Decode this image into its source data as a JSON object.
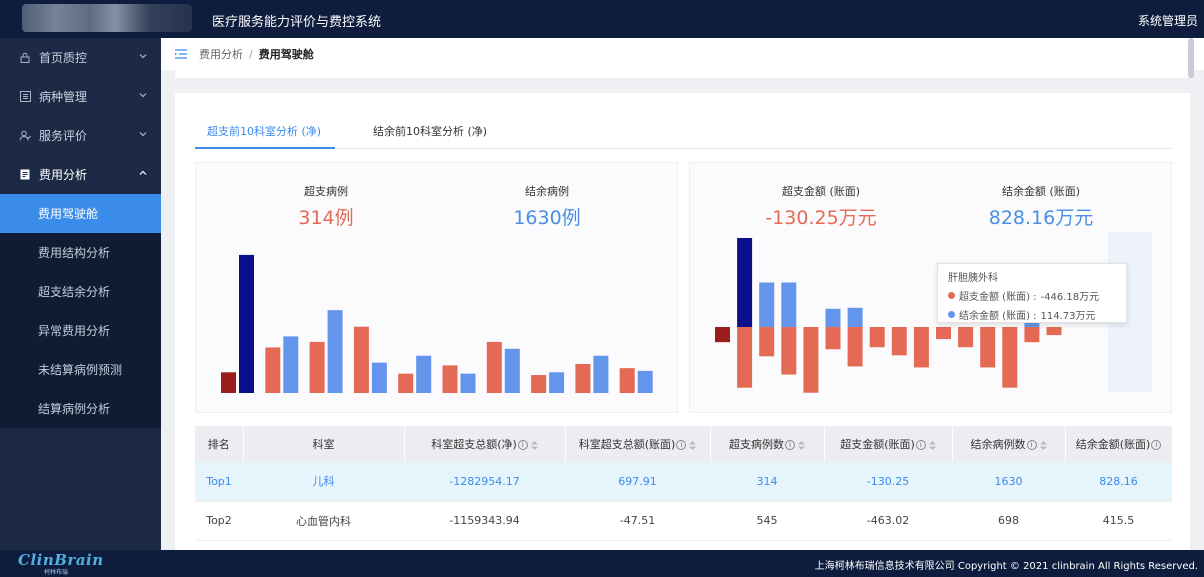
{
  "app": {
    "title": "医疗服务能力评价与费控系统",
    "user": "系统管理员"
  },
  "sidebar": {
    "groups": [
      {
        "label": "首页质控",
        "icon": "lock-icon"
      },
      {
        "label": "病种管理",
        "icon": "list-icon"
      },
      {
        "label": "服务评价",
        "icon": "user-review-icon"
      },
      {
        "label": "费用分析",
        "icon": "document-icon"
      }
    ],
    "sub_items": [
      "费用驾驶舱",
      "费用结构分析",
      "超支结余分析",
      "异常费用分析",
      "未结算病例预测",
      "结算病例分析"
    ]
  },
  "breadcrumb": {
    "parent": "费用分析",
    "separator": "/",
    "current": "费用驾驶舱"
  },
  "tabs": [
    "超支前10科室分析 (净)",
    "结余前10科室分析 (净)"
  ],
  "left_panel": {
    "stat1": {
      "label": "超支病例",
      "value": "314例"
    },
    "stat2": {
      "label": "结余病例",
      "value": "1630例"
    }
  },
  "right_panel": {
    "stat1": {
      "label": "超支金额 (账面)",
      "value": "-130.25万元"
    },
    "stat2": {
      "label": "结余金额 (账面)",
      "value": "828.16万元"
    }
  },
  "tooltip": {
    "title": "肝胆胰外科",
    "rows": [
      {
        "label": "超支金额 (账面) :",
        "value": "-446.18万元"
      },
      {
        "label": "结余金额 (账面) :",
        "value": "114.73万元"
      }
    ]
  },
  "colors": {
    "overspend": "#e56a55",
    "surplus": "#6495ed",
    "highlight_dark_red": "#9b1c1c",
    "highlight_dark_blue": "#0a0f8c",
    "accent": "#3b8beb"
  },
  "chart_data": [
    {
      "type": "bar",
      "series": [
        {
          "values": [
            15,
            100,
            33,
            41,
            37,
            60,
            48,
            22,
            14,
            27,
            20,
            14,
            37,
            32,
            13,
            15,
            21,
            27,
            18,
            16
          ]
        }
      ],
      "ylim": [
        0,
        105
      ]
    },
    {
      "type": "bar",
      "series": [
        {
          "values": [
            -15,
            -60,
            -29,
            -47,
            -65,
            -22,
            -39,
            -20,
            -28,
            -40,
            -12,
            -20,
            -40,
            -60,
            -15,
            -8
          ]
        },
        {
          "values": [
            88,
            44,
            44,
            0,
            18,
            19,
            0,
            0,
            0,
            0,
            0,
            0,
            0,
            10
          ]
        }
      ],
      "ylim": [
        -70,
        90
      ]
    }
  ],
  "table": {
    "headers": [
      "排名",
      "科室",
      "科室超支总额(净)",
      "科室超支总额(账面)",
      "超支病例数",
      "超支金额(账面)",
      "结余病例数",
      "结余金额(账面)"
    ],
    "rows": [
      [
        "Top1",
        "儿科",
        "-1282954.17",
        "697.91",
        "314",
        "-130.25",
        "1630",
        "828.16"
      ],
      [
        "Top2",
        "心血管内科",
        "-1159343.94",
        "-47.51",
        "545",
        "-463.02",
        "698",
        "415.5"
      ]
    ]
  },
  "footer": {
    "brand": "ClinBrain",
    "brand_sub": "柯林布瑞",
    "copyright": "上海柯林布瑞信息技术有限公司 Copyright © 2021 clinbrain All Rights Reserved."
  }
}
